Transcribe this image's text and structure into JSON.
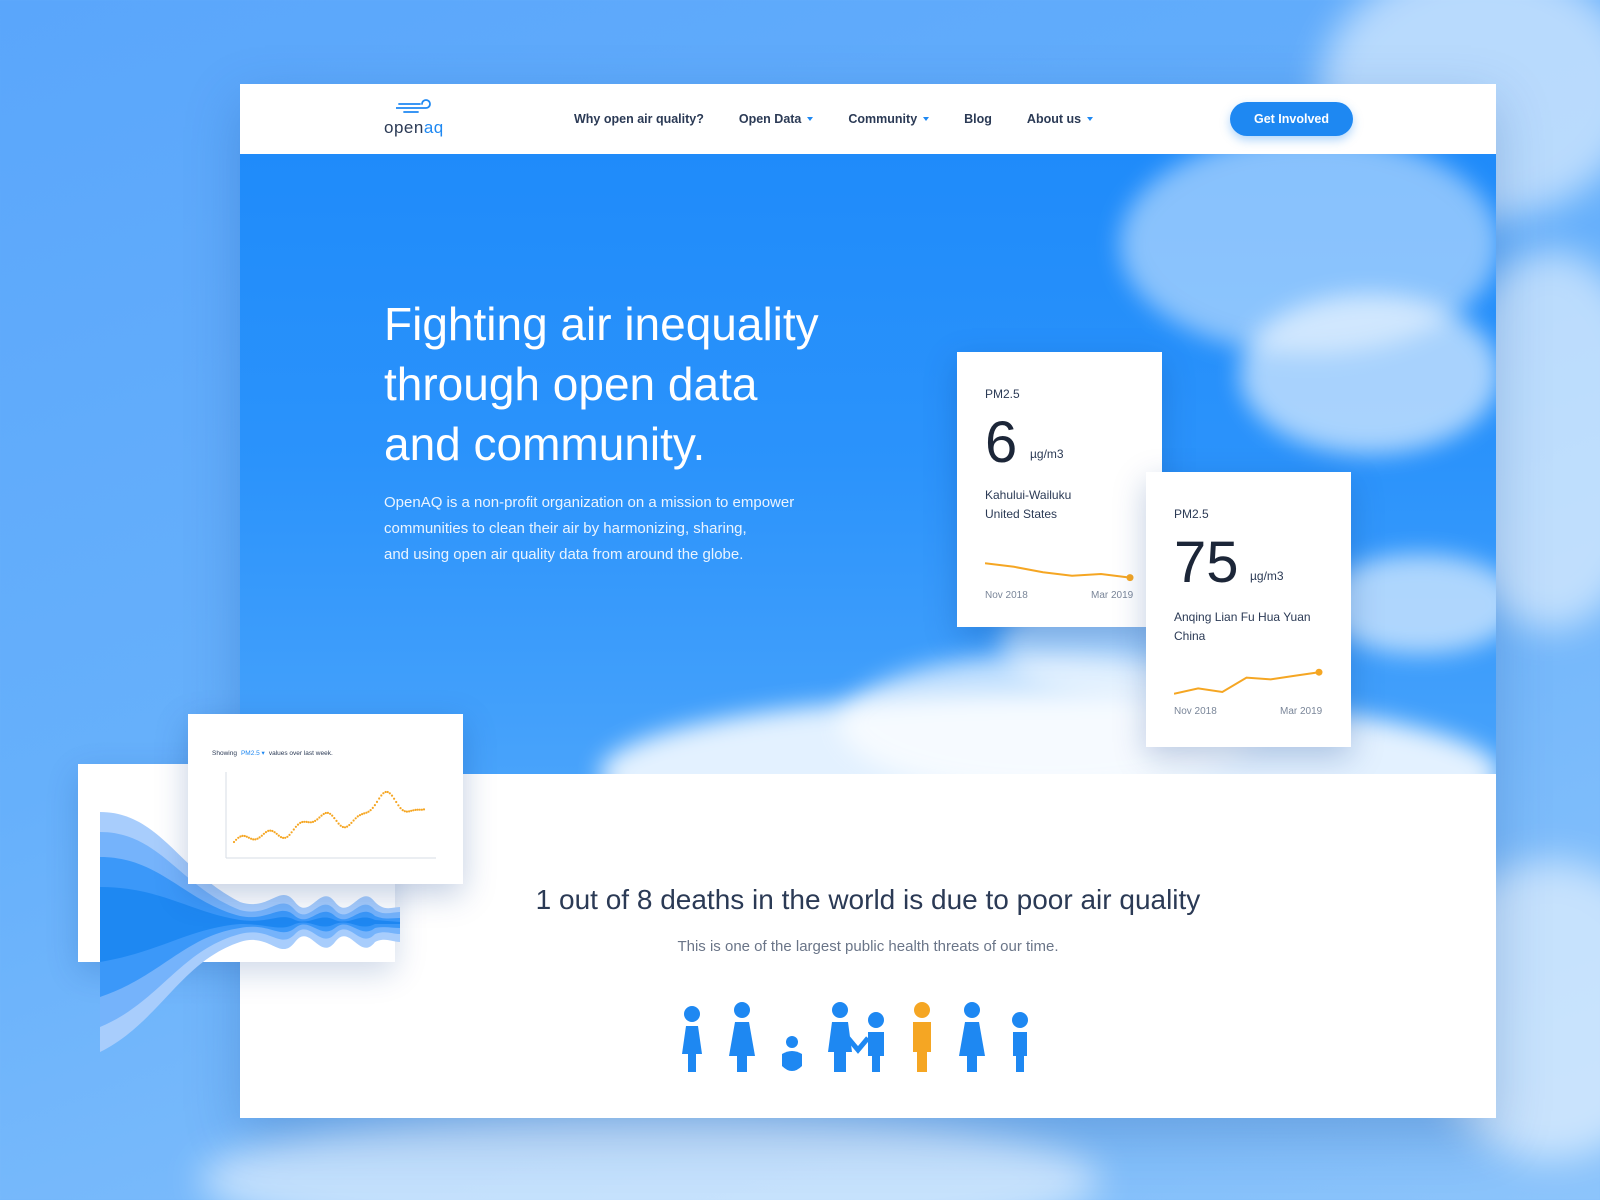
{
  "brand": {
    "name_part1": "open",
    "name_part2": "aq",
    "accent": "#1e88f2",
    "warning": "#f5a623"
  },
  "nav": {
    "items": [
      {
        "label": "Why open air quality?",
        "dropdown": false
      },
      {
        "label": "Open Data",
        "dropdown": true
      },
      {
        "label": "Community",
        "dropdown": true
      },
      {
        "label": "Blog",
        "dropdown": false
      },
      {
        "label": "About us",
        "dropdown": true
      }
    ],
    "cta": "Get Involved"
  },
  "hero": {
    "title_line1": "Fighting air inequality",
    "title_line2": "through open data",
    "title_line3": "and community.",
    "desc_line1": "OpenAQ is a non-profit organization on a mission to empower",
    "desc_line2": "communities to clean their air by harmonizing, sharing,",
    "desc_line3": "and using open air quality data from around the globe."
  },
  "cards": [
    {
      "label": "PM2.5",
      "value": "6",
      "unit": "µg/m3",
      "location": "Kahului-Wailuku",
      "country": "United States",
      "start": "Nov 2018",
      "end": "Mar 2019",
      "trend": [
        0.55,
        0.45,
        0.3,
        0.2,
        0.25,
        0.15
      ]
    },
    {
      "label": "PM2.5",
      "value": "75",
      "unit": "µg/m3",
      "location": "Anqing Lian Fu Hua Yuan",
      "country": "China",
      "start": "Nov 2018",
      "end": "Mar 2019",
      "trend": [
        0.2,
        0.35,
        0.25,
        0.65,
        0.6,
        0.7,
        0.8
      ]
    }
  ],
  "stat": {
    "title": "1 out of 8 deaths in the world is due to poor air quality",
    "subtitle": "This is one of the largest public health threats of our time."
  },
  "mini_chart": {
    "caption_prefix": "Showing",
    "caption_param": "PM2.5",
    "caption_suffix": "values over last week."
  }
}
